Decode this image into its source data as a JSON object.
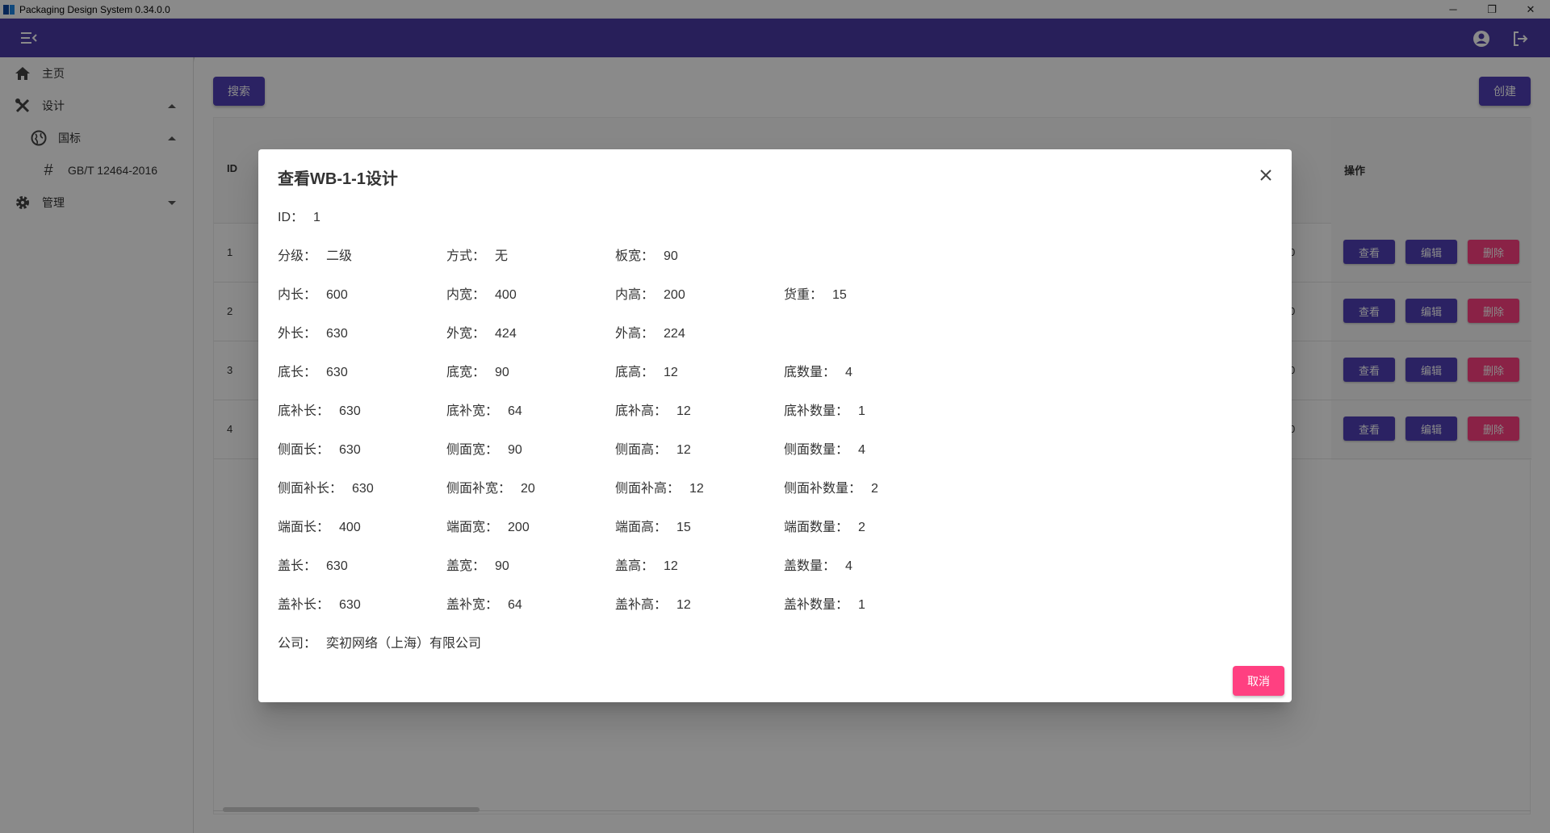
{
  "window": {
    "title": "Packaging Design System 0.34.0.0",
    "minimize": "─",
    "maximize": "❐",
    "close": "✕"
  },
  "appbar": {
    "menu_icon": "menu-collapse-icon",
    "account_icon": "account-circle-icon",
    "logout_icon": "logout-icon"
  },
  "sidebar": {
    "items": [
      {
        "label": "主页",
        "icon": "home-icon"
      },
      {
        "label": "设计",
        "icon": "tools-icon"
      },
      {
        "label": "国标",
        "icon": "globe-icon"
      },
      {
        "label": "GB/T 12464-2016",
        "icon": "hash-icon"
      },
      {
        "label": "管理",
        "icon": "gear-icon"
      }
    ]
  },
  "toolbar": {
    "search_label": "搜索",
    "create_label": "创建"
  },
  "table": {
    "header_id": "ID",
    "header_ops": "操作",
    "rows": [
      {
        "id": "1",
        "trunc": "0"
      },
      {
        "id": "2",
        "trunc": "0"
      },
      {
        "id": "3",
        "trunc": "0"
      },
      {
        "id": "4",
        "trunc": "0"
      }
    ],
    "view_label": "查看",
    "edit_label": "编辑",
    "delete_label": "删除"
  },
  "dialog": {
    "title": "查看WB-1-1设计",
    "cancel_label": "取消",
    "fields": {
      "id": {
        "label": "ID：",
        "value": "1"
      },
      "grade": {
        "label": "分级：",
        "value": "二级"
      },
      "method": {
        "label": "方式：",
        "value": "无"
      },
      "board_width": {
        "label": "板宽：",
        "value": "90"
      },
      "inner_length": {
        "label": "内长：",
        "value": "600"
      },
      "inner_width": {
        "label": "内宽：",
        "value": "400"
      },
      "inner_height": {
        "label": "内高：",
        "value": "200"
      },
      "cargo_weight": {
        "label": "货重：",
        "value": "15"
      },
      "outer_length": {
        "label": "外长：",
        "value": "630"
      },
      "outer_width": {
        "label": "外宽：",
        "value": "424"
      },
      "outer_height": {
        "label": "外高：",
        "value": "224"
      },
      "base_length": {
        "label": "底长：",
        "value": "630"
      },
      "base_width": {
        "label": "底宽：",
        "value": "90"
      },
      "base_height": {
        "label": "底高：",
        "value": "12"
      },
      "base_count": {
        "label": "底数量：",
        "value": "4"
      },
      "base_sup_length": {
        "label": "底补长：",
        "value": "630"
      },
      "base_sup_width": {
        "label": "底补宽：",
        "value": "64"
      },
      "base_sup_height": {
        "label": "底补高：",
        "value": "12"
      },
      "base_sup_count": {
        "label": "底补数量：",
        "value": "1"
      },
      "side_length": {
        "label": "侧面长：",
        "value": "630"
      },
      "side_width": {
        "label": "侧面宽：",
        "value": "90"
      },
      "side_height": {
        "label": "侧面高：",
        "value": "12"
      },
      "side_count": {
        "label": "侧面数量：",
        "value": "4"
      },
      "side_sup_length": {
        "label": "侧面补长：",
        "value": "630"
      },
      "side_sup_width": {
        "label": "侧面补宽：",
        "value": "20"
      },
      "side_sup_height": {
        "label": "侧面补高：",
        "value": "12"
      },
      "side_sup_count": {
        "label": "侧面补数量：",
        "value": "2"
      },
      "end_length": {
        "label": "端面长：",
        "value": "400"
      },
      "end_width": {
        "label": "端面宽：",
        "value": "200"
      },
      "end_height": {
        "label": "端面高：",
        "value": "15"
      },
      "end_count": {
        "label": "端面数量：",
        "value": "2"
      },
      "lid_length": {
        "label": "盖长：",
        "value": "630"
      },
      "lid_width": {
        "label": "盖宽：",
        "value": "90"
      },
      "lid_height": {
        "label": "盖高：",
        "value": "12"
      },
      "lid_count": {
        "label": "盖数量：",
        "value": "4"
      },
      "lid_sup_length": {
        "label": "盖补长：",
        "value": "630"
      },
      "lid_sup_width": {
        "label": "盖补宽：",
        "value": "64"
      },
      "lid_sup_height": {
        "label": "盖补高：",
        "value": "12"
      },
      "lid_sup_count": {
        "label": "盖补数量：",
        "value": "1"
      },
      "company": {
        "label": "公司：",
        "value": "奕初网络（上海）有限公司"
      }
    }
  },
  "colors": {
    "primary": "#5140b8",
    "appbar": "#4a3aa6",
    "danger": "#ff4081"
  }
}
